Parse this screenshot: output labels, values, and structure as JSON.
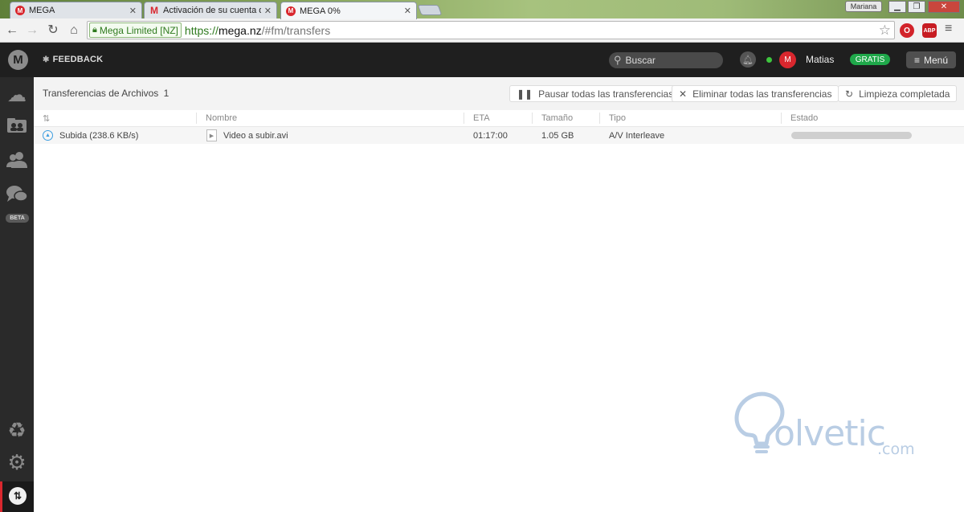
{
  "browser": {
    "tabs": [
      {
        "favicon": "M",
        "title": "MEGA",
        "close": "✕"
      },
      {
        "favicon": "M",
        "title": "Activación de su cuenta d",
        "close": "✕"
      },
      {
        "favicon": "M",
        "title": "MEGA 0%",
        "close": "✕"
      }
    ],
    "profile_name": "Mariana",
    "ev_label": "Mega Limited [NZ]",
    "url_scheme": "https://",
    "url_host": "mega.nz",
    "url_path": "/#fm/transfers"
  },
  "topbar": {
    "feedback_label": "FEEDBACK",
    "search_placeholder": "Buscar",
    "avatar_letter": "M",
    "username": "Matias",
    "plan_badge": "GRATIS",
    "menu_label": "Menú"
  },
  "sidebar": {
    "beta_label": "BETA"
  },
  "transfers": {
    "title": "Transferencias de Archivos",
    "count": "1",
    "actions": {
      "pause_all": "Pausar todas las transferencias",
      "remove_all": "Eliminar todas las transferencias",
      "clear_completed": "Limpieza completada"
    },
    "columns": {
      "name": "Nombre",
      "eta": "ETA",
      "size": "Tamaño",
      "type": "Tipo",
      "status": "Estado"
    },
    "rows": [
      {
        "direction": "Subida (238.6 KB/s)",
        "name": "Video a subir.avi",
        "eta": "01:17:00",
        "size": "1.05 GB",
        "type": "A/V Interleave",
        "progress": 0
      }
    ]
  },
  "watermark": {
    "text": "olvetic",
    "suffix": ".com"
  },
  "colors": {
    "mega_red": "#d9272e",
    "topbar_bg": "#1f1f1f",
    "sidebar_bg": "#2a2a2a",
    "gratis_green": "#1fa84a",
    "upload_blue": "#3d9ee0"
  }
}
